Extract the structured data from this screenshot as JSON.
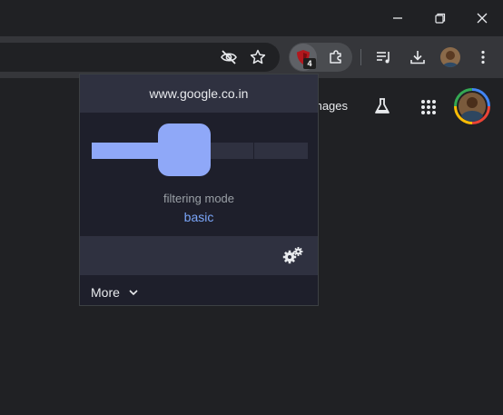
{
  "window": {
    "minimize_icon": "minimize-icon",
    "restore_icon": "restore-icon",
    "close_icon": "close-icon"
  },
  "toolbar": {
    "hide_icon": "eye-off-icon",
    "bookmark_icon": "star-icon",
    "ublock_badge": "4",
    "extensions_icon": "puzzle-icon",
    "reading_list_icon": "reading-list-icon",
    "downloads_icon": "download-icon",
    "menu_icon": "kebab-menu-icon"
  },
  "google": {
    "images_label": "mages"
  },
  "popup": {
    "hostname": "www.google.co.in",
    "filtering_label": "filtering mode",
    "filtering_value": "basic",
    "filtering_level_index": 1,
    "filtering_levels_total": 4,
    "more_label": "More",
    "colors": {
      "accent": "#8fa8f8",
      "panel": "#2f3140",
      "body": "#1e1f2b",
      "mode_text": "#7aa5f8"
    }
  }
}
